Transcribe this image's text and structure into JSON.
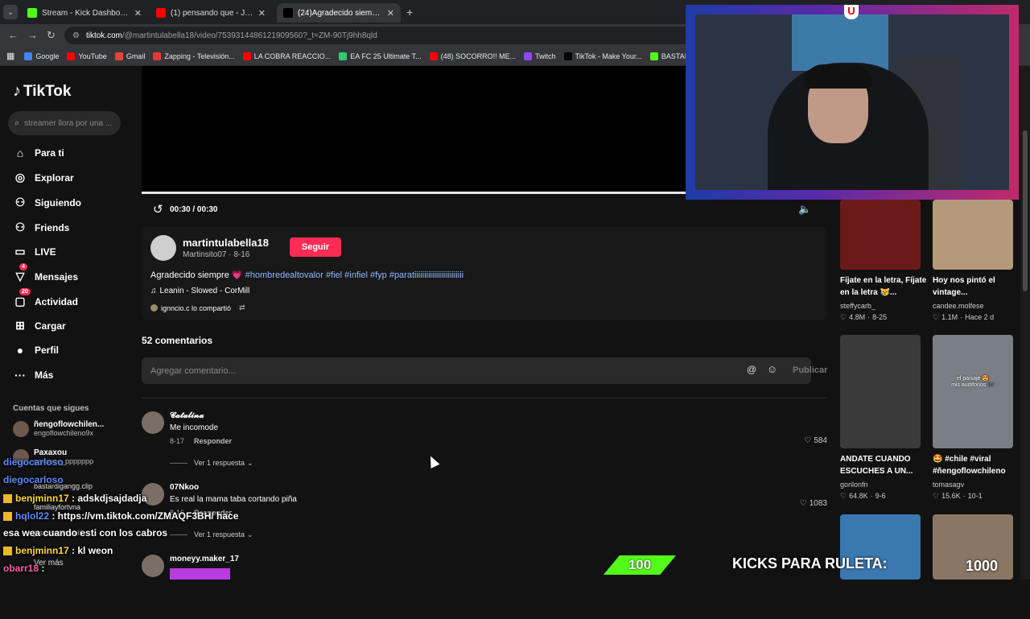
{
  "browser": {
    "tabs": [
      {
        "title": "Stream - Kick Dashboard",
        "favicon": "kick-icon",
        "color": "#53fc18",
        "active": false
      },
      {
        "title": "(1) pensando que - Juanka, ben",
        "favicon": "youtube-icon",
        "color": "#ff0000",
        "active": false
      },
      {
        "title": "(24)Agradecido siempre 💗",
        "favicon": "tiktok-icon",
        "color": "#000000",
        "active": true
      }
    ],
    "url_host": "tiktok.com",
    "url_path": "/@martintulabella18/video/7539314486121909560?_t=ZM-90Tj9hh8qld",
    "bookmarks": [
      {
        "label": "Google",
        "color": "#4285f4"
      },
      {
        "label": "YouTube",
        "color": "#ff0000"
      },
      {
        "label": "Gmail",
        "color": "#ea4335"
      },
      {
        "label": "Zapping - Televisión...",
        "color": "#e53935"
      },
      {
        "label": "LA COBRA REACCIO...",
        "color": "#ff0000"
      },
      {
        "label": "EA FC 25 Ultimate T...",
        "color": "#2ecc71"
      },
      {
        "label": "(48) SOCORRO!! ME...",
        "color": "#ff0000"
      },
      {
        "label": "Twitch",
        "color": "#9146ff"
      },
      {
        "label": "TikTok - Make Your...",
        "color": "#000000"
      },
      {
        "label": "BASTARDIGANGG |...",
        "color": "#53fc18"
      }
    ]
  },
  "sidebar": {
    "logo": "TikTok",
    "search_placeholder": "streamer llora por una ...",
    "items": [
      {
        "label": "Para ti",
        "icon": "home-icon",
        "glyph": "⌂"
      },
      {
        "label": "Explorar",
        "icon": "compass-icon",
        "glyph": "◎"
      },
      {
        "label": "Siguiendo",
        "icon": "following-icon",
        "glyph": "⚇"
      },
      {
        "label": "Friends",
        "icon": "friends-icon",
        "glyph": "⚇"
      },
      {
        "label": "LIVE",
        "icon": "live-icon",
        "glyph": "▭"
      },
      {
        "label": "Mensajes",
        "icon": "messages-icon",
        "glyph": "▽",
        "badge": "4"
      },
      {
        "label": "Actividad",
        "icon": "activity-icon",
        "glyph": "▢",
        "badge": "20"
      },
      {
        "label": "Cargar",
        "icon": "upload-icon",
        "glyph": "⊞"
      },
      {
        "label": "Perfil",
        "icon": "profile-icon",
        "glyph": "●"
      },
      {
        "label": "Más",
        "icon": "more-icon",
        "glyph": "···"
      }
    ],
    "following_title": "Cuentas que sigues",
    "following": [
      {
        "name": "ñengoflowchilen...",
        "handle": "engoflowchileno9x"
      },
      {
        "name": "Paxaxou",
        "handle": "paxaxou_ppppppp"
      },
      {
        "name": "bastardigangg",
        "handle": "bastardigangg.clip"
      },
      {
        "name": "familiayfortvna",
        "handle": "familiayfortvna"
      },
      {
        "name": "jessusssmathiii",
        "handle": "jessusssmathiii"
      }
    ],
    "see_more": "Ver más"
  },
  "player": {
    "time": "00:30 / 00:30",
    "progress": 1.0
  },
  "post": {
    "username": "martintulabella18",
    "subline": "Martinsito07 · 8-16",
    "follow_label": "Seguir",
    "caption": "Agradecido siempre 💗",
    "hashtags": "#hombredealtovalor #fiel #infiel #fyp #paratiiiiiiiiiiiiiiiiiiiiiiiii",
    "music": "Leanin - Slowed - CorMill",
    "shared_by": "ignncio.c lo compartió"
  },
  "comments": {
    "count_label": "52 comentarios",
    "input_placeholder": "Agregar comentario...",
    "publish_label": "Publicar",
    "items": [
      {
        "user": "𝓒𝓪𝓽𝓪𝓵𝓲𝓷𝓪",
        "text": "Me incomode",
        "date": "8-17",
        "reply": "Responder",
        "likes": "584",
        "replies": "Ver 1 respuesta"
      },
      {
        "user": "07Nkoo",
        "text": "Es real la mama taba cortando piña",
        "date": "8-16",
        "reply": "Responder",
        "likes": "1083",
        "replies": "Ver 1 respuesta"
      },
      {
        "user": "moneyy.maker_17",
        "text": "",
        "date": "",
        "reply": "",
        "likes": "",
        "replies": ""
      }
    ]
  },
  "related": [
    {
      "title": "Fíjate en la letra, Fíjate en la letra 😿...",
      "user": "steffycarb_",
      "likes": "4.8M",
      "date": "8-25",
      "thumb": "#6b1a1a"
    },
    {
      "title": "Hoy nos pintó el vintage...",
      "user": "candee.molfese",
      "likes": "1.1M",
      "date": "Hace 2 d",
      "thumb": "#b49a7a"
    },
    {
      "title": "ANDATE CUANDO ESCUCHES A UN...",
      "user": "gorilonfn",
      "likes": "64.8K",
      "date": "9-6",
      "thumb": "#3a3a3a"
    },
    {
      "title": "🤩 #chile #viral #ñengoflowchileno",
      "user": "tomasagv",
      "likes": "15.6K",
      "date": "10-1",
      "thumb": "#7a7f86"
    },
    {
      "title": "",
      "user": "",
      "likes": "",
      "date": "",
      "thumb": "#3b78b0"
    },
    {
      "title": "",
      "user": "",
      "likes": "",
      "date": "",
      "thumb": "#8a7664"
    }
  ],
  "thumb_overlay_text": "el paisaje 😍\nmis audifonos 🎶",
  "chat": [
    {
      "user": "diegocarloso",
      "text": "",
      "color": "#5c8cff"
    },
    {
      "user": "diegocarloso",
      "text": "",
      "color": "#5c8cff"
    },
    {
      "user": "benjminn17",
      "text": " : adskdjsajdadja",
      "color": "#ffd83a"
    },
    {
      "user": "hqlol22",
      "text": " : https://vm.tiktok.com/ZMAQF3BH/ hace",
      "color": "#5c8cff"
    },
    {
      "user": "",
      "text": "esa wea cuando esti con los cabros",
      "color": "#ffffff"
    },
    {
      "user": "benjminn17",
      "text": " : kl weon",
      "color": "#ffd83a"
    },
    {
      "user": "obarr18",
      "text": " :",
      "color": "#ff5ca8"
    }
  ],
  "overlay": {
    "kicks_left": "100",
    "kicks_label": "KICKS PARA RULETA:",
    "kicks_right": "1000"
  }
}
